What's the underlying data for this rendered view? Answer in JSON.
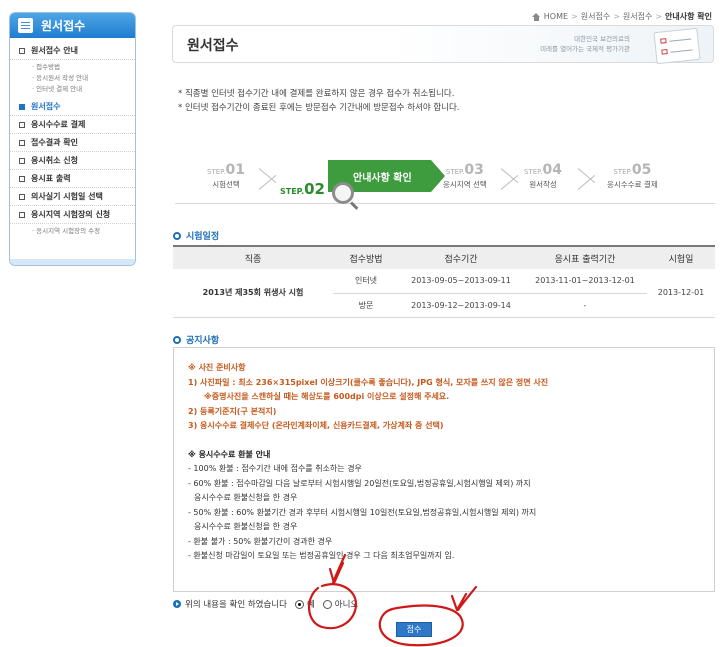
{
  "sidebar": {
    "title": "원서접수",
    "items": [
      {
        "label": "원서접수 안내",
        "active": false,
        "sub": [
          "접수방법",
          "응시원서 작성 안내",
          "인터넷 결제 안내"
        ]
      },
      {
        "label": "원서접수",
        "active": true,
        "sub": []
      },
      {
        "label": "응시수수료 결제",
        "active": false,
        "sub": []
      },
      {
        "label": "접수결과 확인",
        "active": false,
        "sub": []
      },
      {
        "label": "응시취소 신청",
        "active": false,
        "sub": []
      },
      {
        "label": "응시표 출력",
        "active": false,
        "sub": []
      },
      {
        "label": "의사실기 시험일 선택",
        "active": false,
        "sub": []
      },
      {
        "label": "응시지역 시험장의 신청",
        "active": false,
        "sub": [
          "응시지역 시험장의 수정"
        ]
      }
    ]
  },
  "breadcrumb": {
    "home": "HOME",
    "items": [
      "원서접수",
      "원서접수"
    ],
    "current": "안내사항 확인"
  },
  "header": {
    "title": "원서접수",
    "slogan_line1": "대한민국 보건의료의",
    "slogan_line2": "미래를 열어가는 국제적 평가기관"
  },
  "notes": [
    "직종별 인터넷 접수기간 내에 결제를 완료하지 않은 경우 접수가 취소됩니다.",
    "인터넷 접수기간이 종료된 후에는 방문접수 기간내에 방문접수 하셔야 합니다."
  ],
  "steps": [
    {
      "label": "STEP.",
      "num": "01",
      "name": "시험선택"
    },
    {
      "label": "STEP.",
      "num": "02",
      "name": "안내사항 확인"
    },
    {
      "label": "STEP.",
      "num": "03",
      "name": "응시지역 선택"
    },
    {
      "label": "STEP.",
      "num": "04",
      "name": "원서작성"
    },
    {
      "label": "STEP.",
      "num": "05",
      "name": "응시수수료 결제"
    }
  ],
  "schedule": {
    "title": "시험일정",
    "headers": [
      "직종",
      "접수방법",
      "접수기간",
      "응시표 출력기간",
      "시험일"
    ],
    "exam": "2013년 제35회 위생사 시험",
    "rows": [
      {
        "method": "인터넷",
        "period": "2013-09-05~2013-09-11",
        "print": "2013-11-01~2013-12-01"
      },
      {
        "method": "방문",
        "period": "2013-09-12~2013-09-14",
        "print": "-"
      }
    ],
    "exam_date": "2013-12-01"
  },
  "notice": {
    "title": "공지사항",
    "photo_title": "※ 사진 준비사항",
    "photo_1": "1) 사진파일 : 최소 236×315pixel 이상크기(클수록 좋습니다), JPG 형식, 모자를 쓰지 않은 정면 사진",
    "photo_1b": "※증명사진을 스캔하실 때는 해상도를 600dpi 이상으로 설정해 주세요.",
    "photo_2": "2) 등록기준지(구 본적지)",
    "photo_3": "3) 응시수수료 결제수단 (온라인계좌이체, 신용카드결제, 가상계좌 중 선택)",
    "refund_title": "※ 응시수수료 환불 안내",
    "refund": [
      "- 100% 환불 : 접수기간 내에 접수를 취소하는 경우",
      "- 60% 환불 : 접수마감일 다음 날로부터 시험시행일 20일전(토요일,법정공휴일,시험시행일 제외) 까지",
      "  응시수수료 환불신청을 한 경우",
      "- 50% 환불 : 60% 환불기간 경과 후부터 시험시행일 10일전(토요일,법정공휴일,시험시행일 제외) 까지",
      "  응시수수료 환불신청을 한 경우",
      "- 환불 불가 : 50% 환불기간이 경과한 경우",
      "- 환불신청 마감일이 토요일 또는 법정공휴일인 경우 그 다음 최초업무일까지 임."
    ]
  },
  "confirm": {
    "question": "위의 내용을 확인 하였습니다",
    "yes": "예",
    "no": "아니오",
    "selected": "yes",
    "submit": "접수"
  },
  "colors": {
    "accent": "#1d6fb8",
    "step_active": "#3e9b3e",
    "notice_red": "#c65a1e",
    "annotation": "#d01818"
  }
}
